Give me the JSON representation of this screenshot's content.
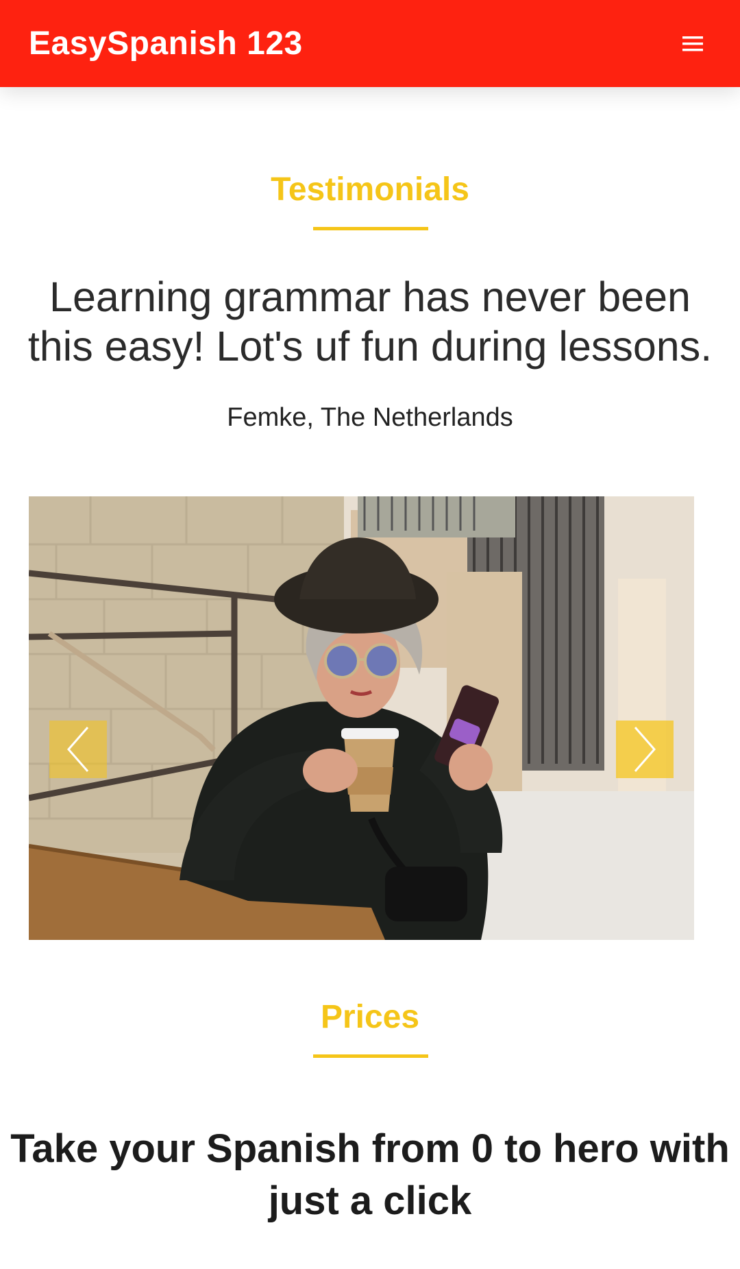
{
  "navbar": {
    "brand": "EasySpanish 123",
    "menu_icon": "hamburger-menu-icon",
    "background_color": "#fe2210"
  },
  "testimonials": {
    "title": "Testimonials",
    "quote": "Learning grammar has never been this easy! Lot's uf fun during lessons.",
    "author": "Femke, The Netherlands",
    "accent_color": "#f5c518"
  },
  "carousel": {
    "prev_icon": "chevron-left-icon",
    "next_icon": "chevron-right-icon",
    "image_alt": "Woman with hat and sunglasses holding coffee cup and phone"
  },
  "prices": {
    "title": "Prices",
    "headline": "Take your Spanish from 0 to hero with just a click"
  }
}
